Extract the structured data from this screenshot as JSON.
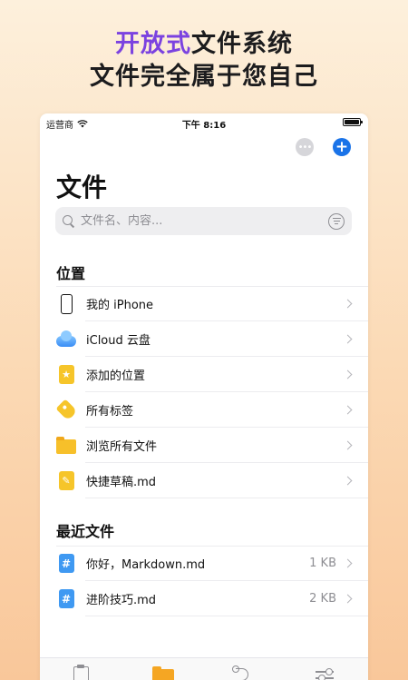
{
  "promo": {
    "line1_accent": "开放式",
    "line1_rest": "文件系统",
    "line2": "文件完全属于您自己"
  },
  "status_bar": {
    "carrier": "运营商",
    "time": "下午 8:16"
  },
  "header": {
    "title": "文件",
    "more_icon": "ellipsis-circle-icon",
    "add_icon": "plus-circle-icon"
  },
  "search": {
    "placeholder": "文件名、内容..."
  },
  "locations": {
    "heading": "位置",
    "items": [
      {
        "label": "我的 iPhone",
        "icon": "iphone-icon"
      },
      {
        "label": "iCloud 云盘",
        "icon": "icloud-icon"
      },
      {
        "label": "添加的位置",
        "icon": "star-bookmark-icon"
      },
      {
        "label": "所有标签",
        "icon": "tag-icon"
      },
      {
        "label": "浏览所有文件",
        "icon": "folder-icon"
      },
      {
        "label": "快捷草稿.md",
        "icon": "draft-icon"
      }
    ]
  },
  "recent": {
    "heading": "最近文件",
    "items": [
      {
        "label": "你好，Markdown.md",
        "size": "1 KB",
        "icon": "markdown-file-icon"
      },
      {
        "label": "进阶技巧.md",
        "size": "2 KB",
        "icon": "markdown-file-icon"
      }
    ]
  },
  "tabbar": {
    "tabs": [
      {
        "icon": "clipboard-icon"
      },
      {
        "icon": "folder-icon",
        "selected": true
      },
      {
        "icon": "route-icon"
      },
      {
        "icon": "sliders-icon"
      }
    ]
  },
  "colors": {
    "accent": "#7b42e0",
    "primary_blue": "#1a73e8",
    "folder_yellow": "#f7c02a"
  }
}
